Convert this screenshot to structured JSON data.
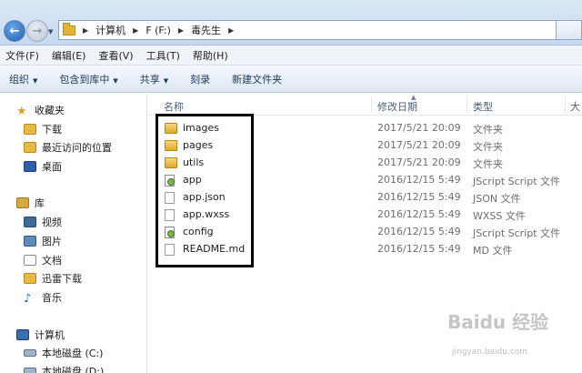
{
  "address": {
    "path": [
      "计算机",
      "F (F:)",
      "毒先生"
    ]
  },
  "menu": [
    "文件(F)",
    "编辑(E)",
    "查看(V)",
    "工具(T)",
    "帮助(H)"
  ],
  "toolbar": {
    "organize": "组织",
    "include_library": "包含到库中",
    "share": "共享",
    "burn": "刻录",
    "new_folder": "新建文件夹"
  },
  "nav": {
    "favorites": "收藏夹",
    "downloads": "下载",
    "recent": "最近访问的位置",
    "desktop": "桌面",
    "libraries": "库",
    "videos": "视频",
    "pictures": "图片",
    "documents": "文档",
    "thunder": "迅雷下载",
    "music": "音乐",
    "computer": "计算机",
    "drive_c": "本地磁盘 (C:)",
    "drive_d": "本地磁盘 (D:)"
  },
  "columns": {
    "name": "名称",
    "date": "修改日期",
    "type": "类型",
    "size": "大"
  },
  "files": [
    {
      "name": "images",
      "date": "2017/5/21 20:09",
      "type": "文件夹",
      "icon": "folder-icon"
    },
    {
      "name": "pages",
      "date": "2017/5/21 20:09",
      "type": "文件夹",
      "icon": "folder-icon"
    },
    {
      "name": "utils",
      "date": "2017/5/21 20:09",
      "type": "文件夹",
      "icon": "folder-icon"
    },
    {
      "name": "app",
      "date": "2016/12/15 5:49",
      "type": "JScript Script 文件",
      "icon": "script-file-icon"
    },
    {
      "name": "app.json",
      "date": "2016/12/15 5:49",
      "type": "JSON 文件",
      "icon": "file-icon"
    },
    {
      "name": "app.wxss",
      "date": "2016/12/15 5:49",
      "type": "WXSS 文件",
      "icon": "file-icon"
    },
    {
      "name": "config",
      "date": "2016/12/15 5:49",
      "type": "JScript Script 文件",
      "icon": "script-file-icon"
    },
    {
      "name": "README.md",
      "date": "2016/12/15 5:49",
      "type": "MD 文件",
      "icon": "file-icon"
    }
  ],
  "watermark": {
    "brand": "Baidu 经验",
    "url": "jingyan.baidu.com"
  }
}
